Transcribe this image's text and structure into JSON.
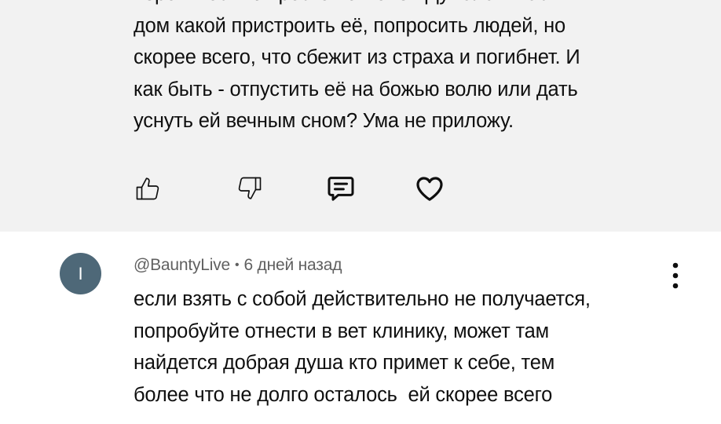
{
  "previous_comment": {
    "text_lines": [
      "вероятностью просто погибнет. Думала в частный",
      "дом какой пристроить её, попросить людей, но",
      "скорее всего, что сбежит из страха и погибнет. И",
      "как быть - отпустить её на божью волю или  дать",
      "уснуть ей вечным сном? Ума не приложу."
    ],
    "actions": {
      "like_icon": "thumb-up-icon",
      "dislike_icon": "thumb-down-icon",
      "reply_icon": "comment-icon",
      "heart_icon": "heart-icon"
    }
  },
  "comment": {
    "avatar_letter": "I",
    "avatar_color": "#4e6878",
    "author": "@BauntyLive",
    "separator": "•",
    "timestamp": "6 дней назад",
    "more_icon": "more-vertical-icon",
    "text_lines": [
      "если взять с собой действительно не получается,",
      "попробуйте отнести в вет клинику, может там",
      "найдется добрая душа кто примет к себе, тем",
      "более что не долго осталось  ей скорее всего"
    ]
  },
  "colors": {
    "highlight_background": "#f2f2f2",
    "text": "#0f0f0f",
    "meta_text": "#606060"
  }
}
